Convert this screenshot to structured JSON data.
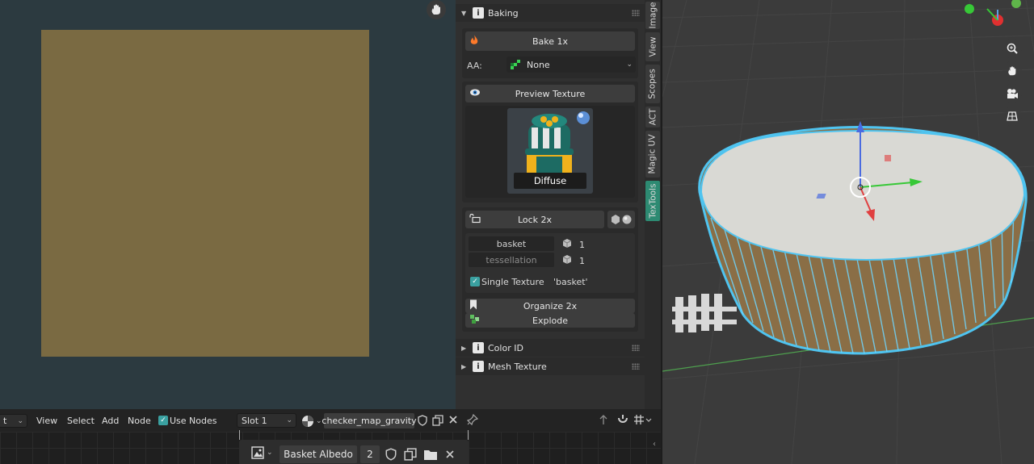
{
  "npanel": {
    "baking": {
      "title": "Baking",
      "bake_label": "Bake 1x",
      "aa_label": "AA:",
      "aa_value": "None",
      "preview_label": "Preview Texture",
      "thumbnail_caption": "Diffuse",
      "lock_label": "Lock 2x",
      "sets": [
        {
          "name": "basket",
          "count": "1"
        },
        {
          "name": "tessellation",
          "count": "1"
        }
      ],
      "single_texture_label": "Single Texture",
      "single_texture_value": "'basket'",
      "organize_label": "Organize 2x",
      "explode_label": "Explode"
    },
    "color_id_title": "Color ID",
    "mesh_texture_title": "Mesh Texture"
  },
  "tabs": [
    {
      "label": "Image",
      "active": false
    },
    {
      "label": "View",
      "active": false
    },
    {
      "label": "Scopes",
      "active": false
    },
    {
      "label": "ACT",
      "active": false
    },
    {
      "label": "Magic UV",
      "active": false
    },
    {
      "label": "TexTools",
      "active": true
    }
  ],
  "node_editor": {
    "left_partial": "t",
    "menu": [
      "View",
      "Select",
      "Add",
      "Node"
    ],
    "use_nodes_label": "Use Nodes",
    "slot": "Slot 1",
    "material": "checker_map_gravity",
    "image_name": "Basket Albedo",
    "image_users": "2"
  },
  "colors": {
    "accent_teal": "#2d8a72",
    "texture_fill": "#7a6a42",
    "selection_outline": "#4fc4f0"
  }
}
